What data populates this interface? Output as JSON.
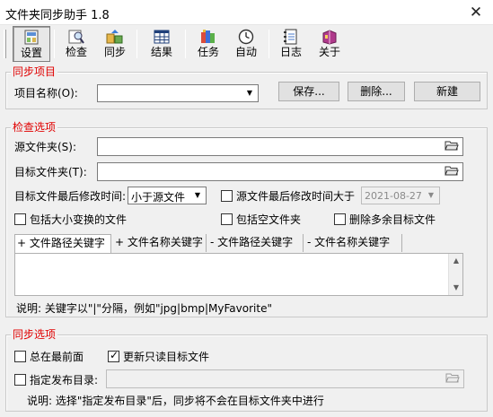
{
  "window": {
    "title": "文件夹同步助手 1.8",
    "close_glyph": "✕"
  },
  "toolbar": {
    "items": [
      {
        "label": "设置",
        "icon": "settings-icon"
      },
      {
        "label": "检查",
        "icon": "inspect-icon"
      },
      {
        "label": "同步",
        "icon": "sync-icon"
      },
      {
        "label": "结果",
        "icon": "results-icon"
      },
      {
        "label": "任务",
        "icon": "tasks-icon"
      },
      {
        "label": "自动",
        "icon": "clock-icon"
      },
      {
        "label": "日志",
        "icon": "log-icon"
      },
      {
        "label": "关于",
        "icon": "about-icon"
      }
    ]
  },
  "sync_project": {
    "legend": "同步项目",
    "project_name_label": "项目名称(O):",
    "project_name_value": "",
    "save_button": "保存...",
    "delete_button": "删除...",
    "new_button": "新建"
  },
  "check_options": {
    "legend": "检查选项",
    "source_folder_label": "源文件夹(S):",
    "source_folder_value": "",
    "target_folder_label": "目标文件夹(T):",
    "target_folder_value": "",
    "target_modify_time_label": "目标文件最后修改时间:",
    "target_modify_time_value": "小于源文件",
    "source_modify_after_label": "源文件最后修改时间大于",
    "source_modify_after_value": "2021-08-27",
    "source_modify_after_checked": false,
    "include_case_label": "包括大小变换的文件",
    "include_case_checked": false,
    "include_empty_label": "包括空文件夹",
    "include_empty_checked": false,
    "delete_extra_label": "删除多余目标文件",
    "delete_extra_checked": false,
    "tabs": [
      "+ 文件路径关键字",
      "+ 文件名称关键字",
      "- 文件路径关键字",
      "- 文件名称关键字"
    ],
    "keywords_value": "",
    "note": "说明: 关键字以\"|\"分隔，例如\"jpg|bmp|MyFavorite\""
  },
  "sync_options": {
    "legend": "同步选项",
    "always_on_top_label": "总在最前面",
    "always_on_top_checked": false,
    "update_readonly_label": "更新只读目标文件",
    "update_readonly_checked": true,
    "publish_dir_label": "指定发布目录:",
    "publish_dir_checked": false,
    "publish_dir_value": "",
    "note": "说明: 选择\"指定发布目录\"后，同步将不会在目标文件夹中进行"
  },
  "colors": {
    "legend": "#e00000",
    "background": "#f0f0f0"
  }
}
